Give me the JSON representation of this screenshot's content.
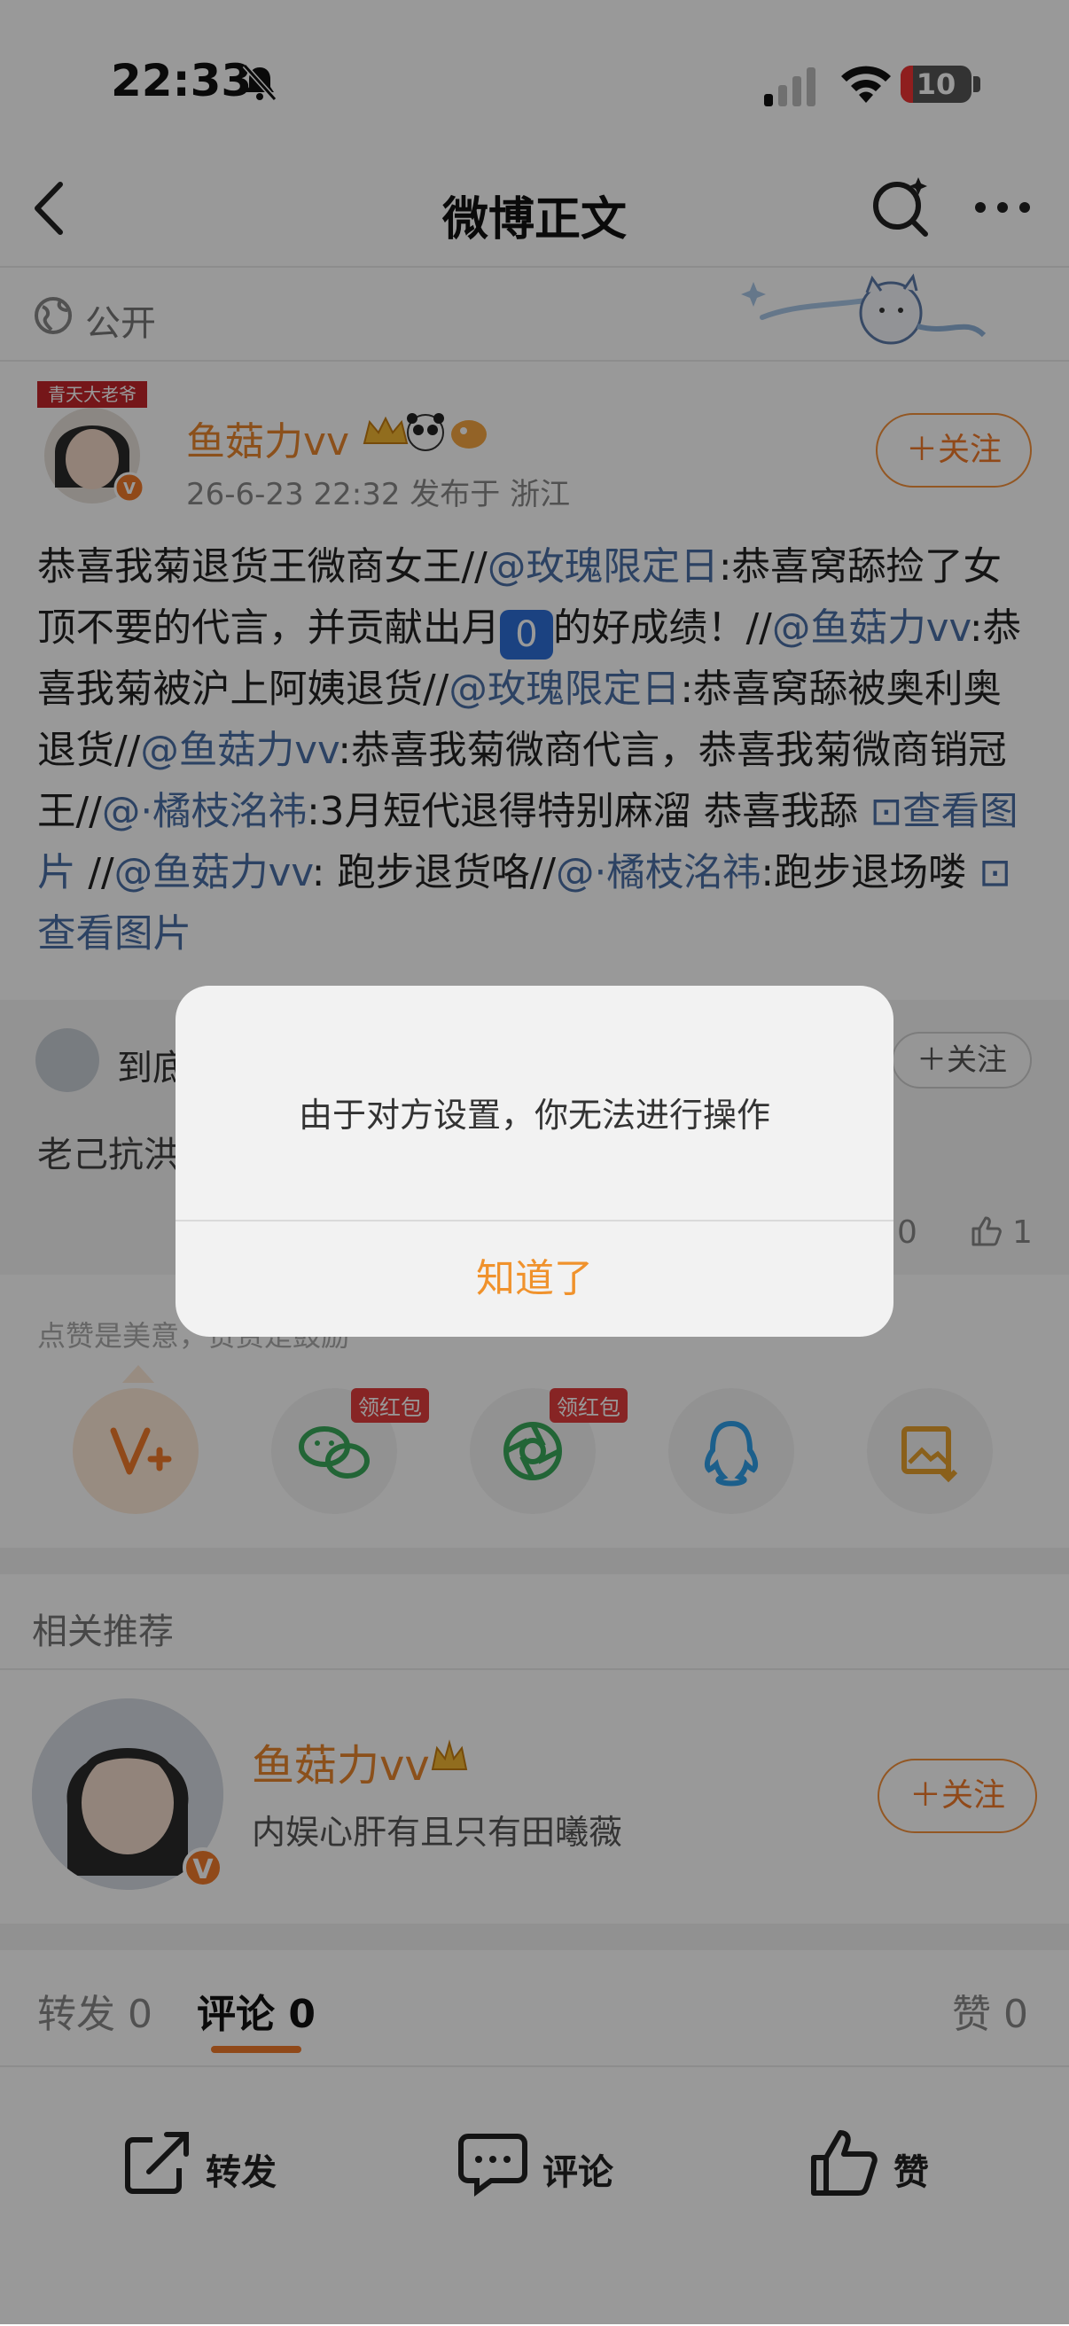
{
  "status_bar": {
    "time": "22:33",
    "battery": "10"
  },
  "nav": {
    "title": "微博正文"
  },
  "visibility": {
    "label": "公开"
  },
  "post": {
    "author": "鱼菇力vv",
    "meta": "26-6-23 22:32  发布于 浙江",
    "follow_label": "＋关注",
    "body": [
      {
        "t": "恭喜我菊退货王微商女王//"
      },
      {
        "t": "@玫瑰限定日",
        "link": true
      },
      {
        "t": ":恭喜窝舔捡了女顶不要的代言，并贡献出月"
      },
      {
        "t": "0",
        "keycap": true
      },
      {
        "t": "的好成绩！//"
      },
      {
        "t": "@鱼菇力vv",
        "link": true
      },
      {
        "t": ":恭喜我菊被沪上阿姨退货//"
      },
      {
        "t": "@玫瑰限定日",
        "link": true
      },
      {
        "t": ":恭喜窝舔被奥利奥退货//"
      },
      {
        "t": "@鱼菇力vv",
        "link": true
      },
      {
        "t": ":恭喜我菊微商代言，恭喜我菊微商销冠王//"
      },
      {
        "t": "@·橘枝洺祎",
        "link": true
      },
      {
        "t": ":3月短代退得特别麻溜 恭喜我舔 "
      },
      {
        "t": "⊡查看图片",
        "link": true
      },
      {
        "t": " //"
      },
      {
        "t": "@鱼菇力vv",
        "link": true
      },
      {
        "t": ": 跑步退货咯//"
      },
      {
        "t": "@·橘枝洺祎",
        "link": true
      },
      {
        "t": ":跑步退场喽 "
      },
      {
        "t": "⊡查看图片",
        "link": true
      }
    ]
  },
  "forward_card": {
    "name": "到底",
    "text": "老己抗洪",
    "follow_label": "＋关注",
    "count_left": "0",
    "like_count": "1"
  },
  "share": {
    "tip": "点赞是美意，赞赏是鼓励",
    "redbag_label": "领红包",
    "icons": [
      "weibo-v-plus-icon",
      "wechat-icon",
      "moments-icon",
      "qq-icon",
      "save-image-icon"
    ]
  },
  "related": {
    "title": "相关推荐",
    "name": "鱼菇力vv",
    "desc": "内娱心肝有且只有田曦薇",
    "follow_label": "＋关注",
    "badge": "V"
  },
  "tabs": {
    "repost": "转发 0",
    "comment": "评论 0",
    "like": "赞 0"
  },
  "bottom": {
    "repost": "转发",
    "comment": "评论",
    "like": "赞"
  },
  "dialog": {
    "message": "由于对方设置，你无法进行操作",
    "button": "知道了"
  },
  "colors": {
    "accent": "#f07a2b",
    "link": "#4a6fa5",
    "dialog_button": "#f0922c"
  }
}
